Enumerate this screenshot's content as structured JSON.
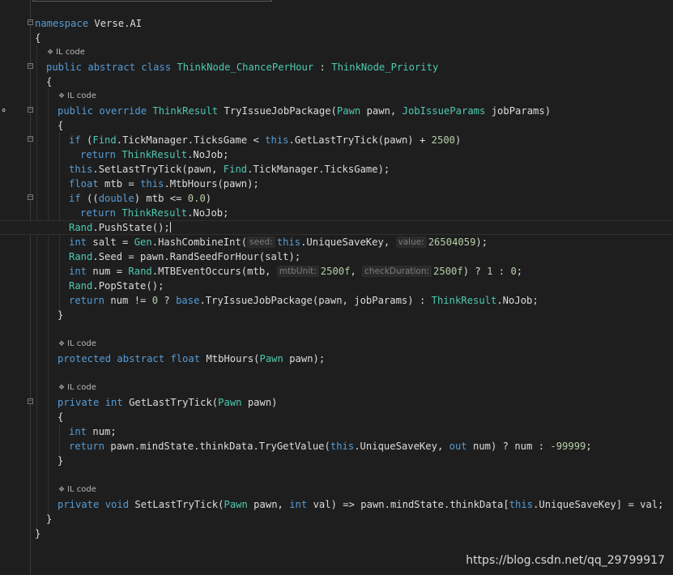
{
  "code_lens": [
    {
      "id": "lens1",
      "text": "IL code"
    },
    {
      "id": "lens2",
      "text": "IL code"
    },
    {
      "id": "lens3",
      "text": "IL code"
    },
    {
      "id": "lens4",
      "text": "IL code"
    },
    {
      "id": "lens5",
      "text": "IL code"
    }
  ],
  "hints": {
    "seed": "seed:",
    "value": "value:",
    "mtbUnit": "mtbUnit:",
    "checkDuration": "checkDuration:"
  },
  "watermark": "https://blog.csdn.net/qq_29799917",
  "tokens": {
    "l1": [
      "namespace",
      " Verse.AI"
    ],
    "l2": [
      "{"
    ],
    "l3": [
      "public",
      " ",
      "abstract",
      " ",
      "class",
      " ",
      "ThinkNode_ChancePerHour",
      " : ",
      "ThinkNode_Priority"
    ],
    "l4": [
      "{"
    ],
    "l5": [
      "public",
      " ",
      "override",
      " ",
      "ThinkResult",
      " TryIssueJobPackage(",
      "Pawn",
      " pawn, ",
      "JobIssueParams",
      " jobParams)"
    ],
    "l6": [
      "{"
    ],
    "l7": [
      "if",
      " (",
      "Find",
      ".TickManager.TicksGame < ",
      "this",
      ".GetLastTryTick(pawn) + ",
      "2500",
      ")"
    ],
    "l8": [
      "return",
      " ",
      "ThinkResult",
      ".NoJob;"
    ],
    "l9": [
      "this",
      ".SetLastTryTick(pawn, ",
      "Find",
      ".TickManager.TicksGame);"
    ],
    "l10": [
      "float",
      " mtb = ",
      "this",
      ".MtbHours(pawn);"
    ],
    "l11": [
      "if",
      " ((",
      "double",
      ") mtb <= ",
      "0.0",
      ")"
    ],
    "l12": [
      "return",
      " ",
      "ThinkResult",
      ".NoJob;"
    ],
    "l13": [
      "Rand",
      ".PushState();"
    ],
    "l14": [
      "int",
      " salt = ",
      "Gen",
      ".HashCombineInt(",
      "this",
      ".UniqueSaveKey, ",
      "26504059",
      ");"
    ],
    "l15": [
      "Rand",
      ".Seed = pawn.RandSeedForHour(salt);"
    ],
    "l16": [
      "int",
      " num = ",
      "Rand",
      ".MTBEventOccurs(mtb, ",
      "2500f",
      ", ",
      "2500f",
      ") ? ",
      "1",
      " : ",
      "0",
      ";"
    ],
    "l17": [
      "Rand",
      ".PopState();"
    ],
    "l18": [
      "return",
      " num != ",
      "0",
      " ? ",
      "base",
      ".TryIssueJobPackage(pawn, jobParams) : ",
      "ThinkResult",
      ".NoJob;"
    ],
    "l19": [
      "}"
    ],
    "l20": [
      "protected",
      " ",
      "abstract",
      " ",
      "float",
      " MtbHours(",
      "Pawn",
      " pawn);"
    ],
    "l21": [
      "private",
      " ",
      "int",
      " GetLastTryTick(",
      "Pawn",
      " pawn)"
    ],
    "l22": [
      "{"
    ],
    "l23": [
      "int",
      " num;"
    ],
    "l24": [
      "return",
      " pawn.mindState.thinkData.TryGetValue(",
      "this",
      ".UniqueSaveKey, ",
      "out",
      " num) ? num : ",
      "-99999",
      ";"
    ],
    "l25": [
      "}"
    ],
    "l26": [
      "private",
      " ",
      "void",
      " SetLastTryTick(",
      "Pawn",
      " pawn, ",
      "int",
      " val) => pawn.mindState.thinkData[",
      "this",
      ".UniqueSaveKey] = val;"
    ],
    "l27": [
      "}"
    ],
    "l28": [
      "}"
    ]
  },
  "colors": {
    "background": "#1e1e1e",
    "keyword": "#569cd6",
    "type": "#4ec9b0",
    "number": "#b5cea8",
    "text": "#dcdcdc"
  }
}
